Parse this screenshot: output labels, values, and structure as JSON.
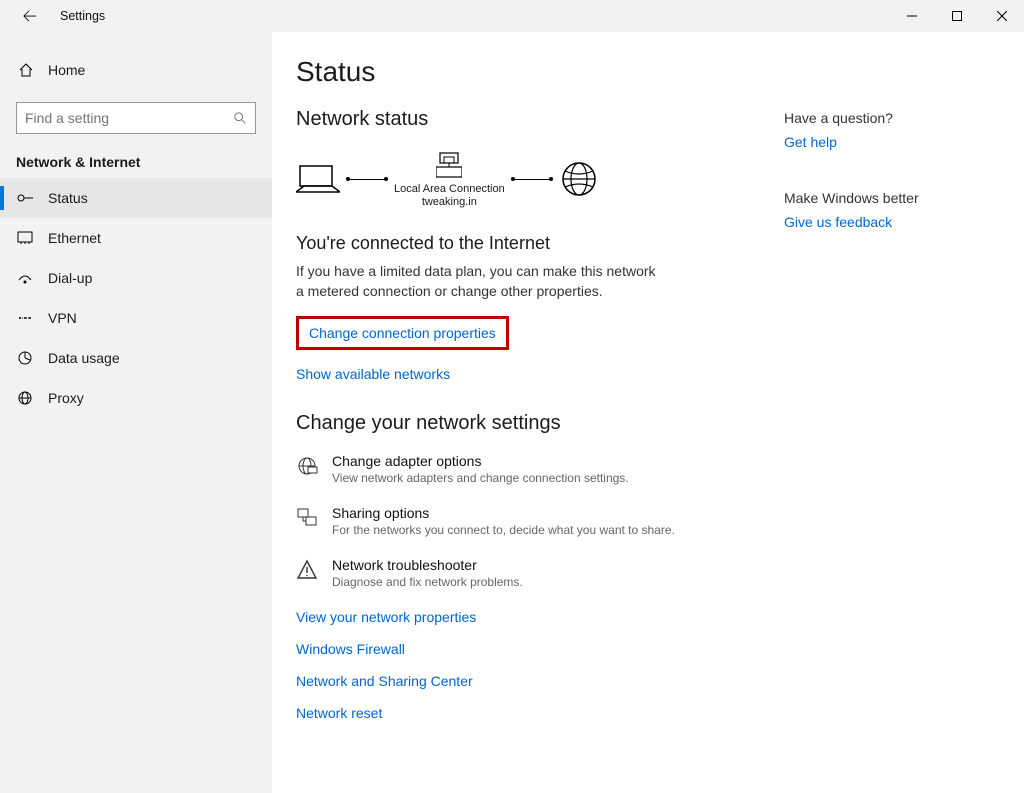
{
  "window": {
    "title": "Settings"
  },
  "sidebar": {
    "home_label": "Home",
    "search_placeholder": "Find a setting",
    "section_label": "Network & Internet",
    "items": [
      {
        "label": "Status"
      },
      {
        "label": "Ethernet"
      },
      {
        "label": "Dial-up"
      },
      {
        "label": "VPN"
      },
      {
        "label": "Data usage"
      },
      {
        "label": "Proxy"
      }
    ]
  },
  "main": {
    "page_title": "Status",
    "network_status_heading": "Network status",
    "connection_name_line1": "Local Area Connection",
    "connection_name_line2": "tweaking.in",
    "connected_heading": "You're connected to the Internet",
    "connected_desc": "If you have a limited data plan, you can make this network a metered connection or change other properties.",
    "change_conn_props": "Change connection properties",
    "show_networks": "Show available networks",
    "change_settings_heading": "Change your network settings",
    "settings": [
      {
        "title": "Change adapter options",
        "desc": "View network adapters and change connection settings."
      },
      {
        "title": "Sharing options",
        "desc": "For the networks you connect to, decide what you want to share."
      },
      {
        "title": "Network troubleshooter",
        "desc": "Diagnose and fix network problems."
      }
    ],
    "links": [
      "View your network properties",
      "Windows Firewall",
      "Network and Sharing Center",
      "Network reset"
    ]
  },
  "aside": {
    "question_title": "Have a question?",
    "get_help": "Get help",
    "improve_title": "Make Windows better",
    "feedback": "Give us feedback"
  }
}
